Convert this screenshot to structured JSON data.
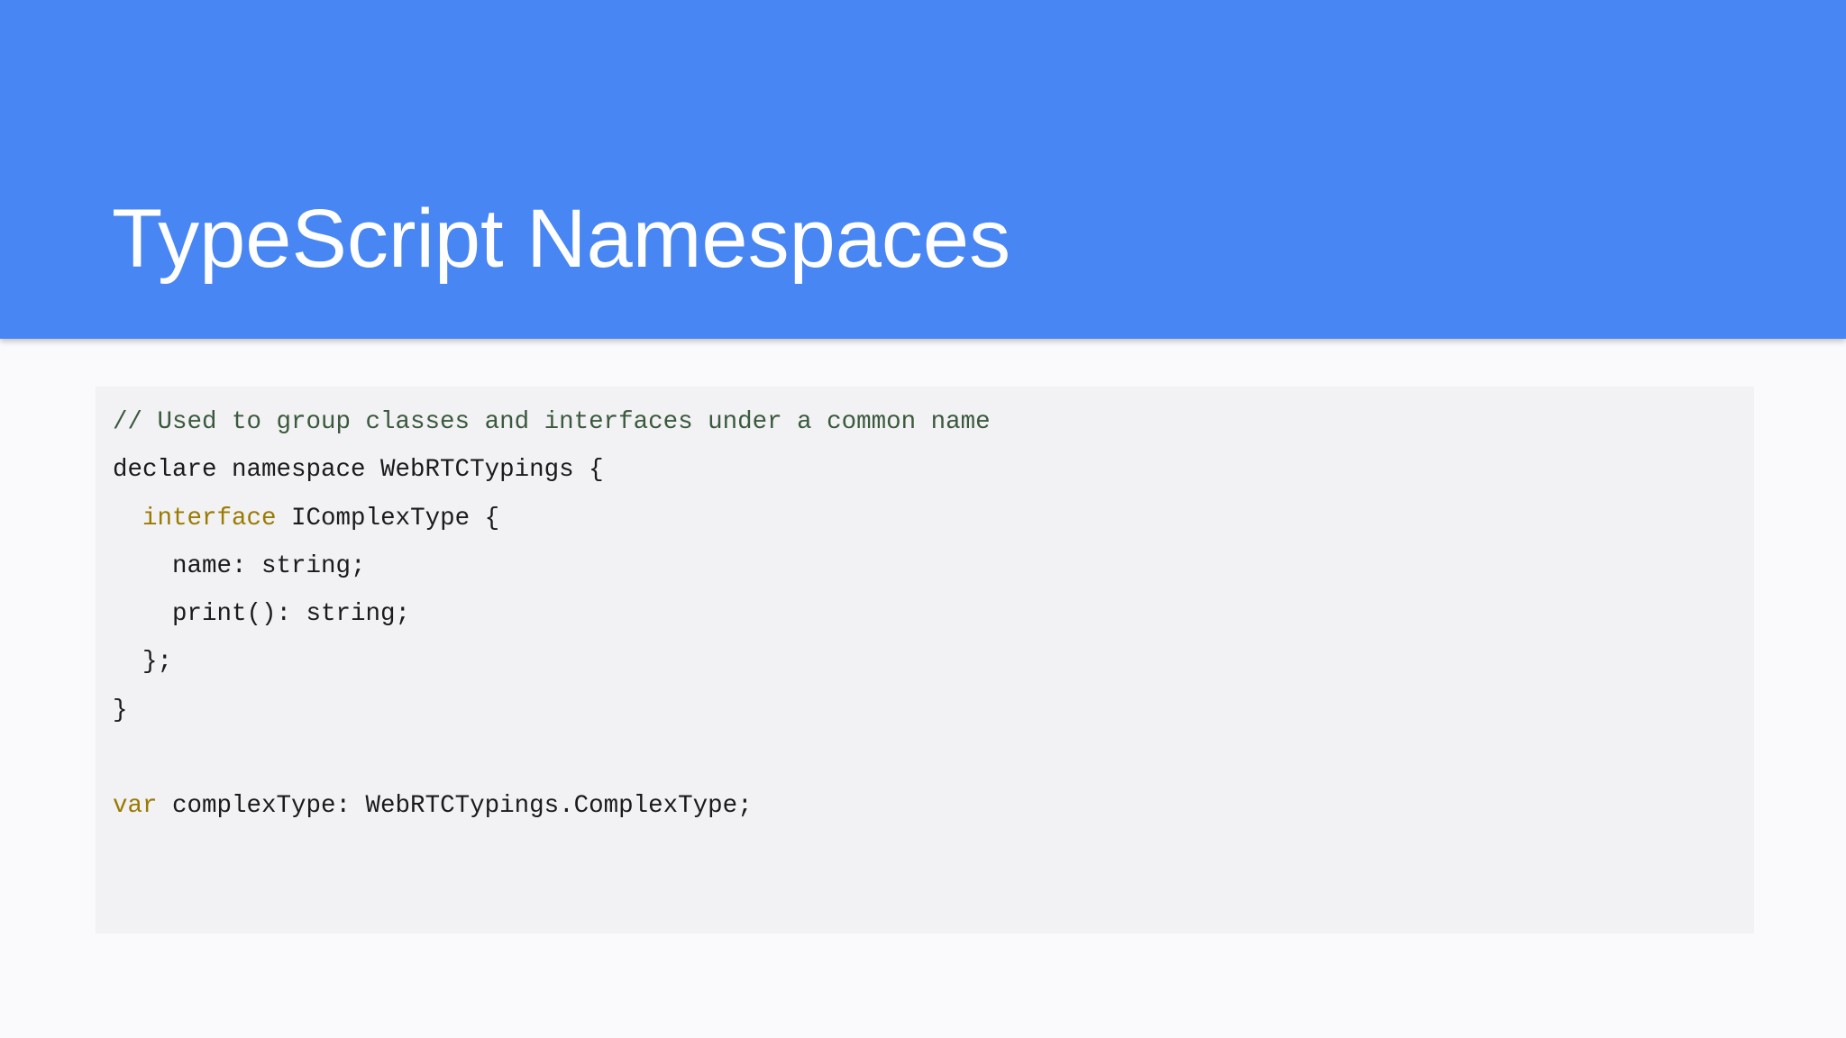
{
  "slide": {
    "title": "TypeScript Namespaces"
  },
  "code": {
    "colors": {
      "comment": "#3a5a3d",
      "keyword": "#9a7b00",
      "plain": "#1b1b1b",
      "header_background": "#4886f4",
      "panel_background": "#f2f1f4"
    },
    "lines": [
      {
        "tokens": [
          {
            "type": "comment",
            "text": "// Used to group classes and interfaces under a common name"
          }
        ]
      },
      {
        "tokens": [
          {
            "type": "plain",
            "text": "declare namespace WebRTCTypings {"
          }
        ]
      },
      {
        "tokens": [
          {
            "type": "plain",
            "text": "  "
          },
          {
            "type": "keyword",
            "text": "interface"
          },
          {
            "type": "plain",
            "text": " IComplexType {"
          }
        ]
      },
      {
        "tokens": [
          {
            "type": "plain",
            "text": "    name: string;"
          }
        ]
      },
      {
        "tokens": [
          {
            "type": "plain",
            "text": "    print(): string;"
          }
        ]
      },
      {
        "tokens": [
          {
            "type": "plain",
            "text": "  };"
          }
        ]
      },
      {
        "tokens": [
          {
            "type": "plain",
            "text": "}"
          }
        ]
      },
      {
        "tokens": [
          {
            "type": "plain",
            "text": ""
          }
        ]
      },
      {
        "tokens": [
          {
            "type": "keyword",
            "text": "var"
          },
          {
            "type": "plain",
            "text": " complexType: WebRTCTypings.ComplexType;"
          }
        ]
      }
    ]
  }
}
